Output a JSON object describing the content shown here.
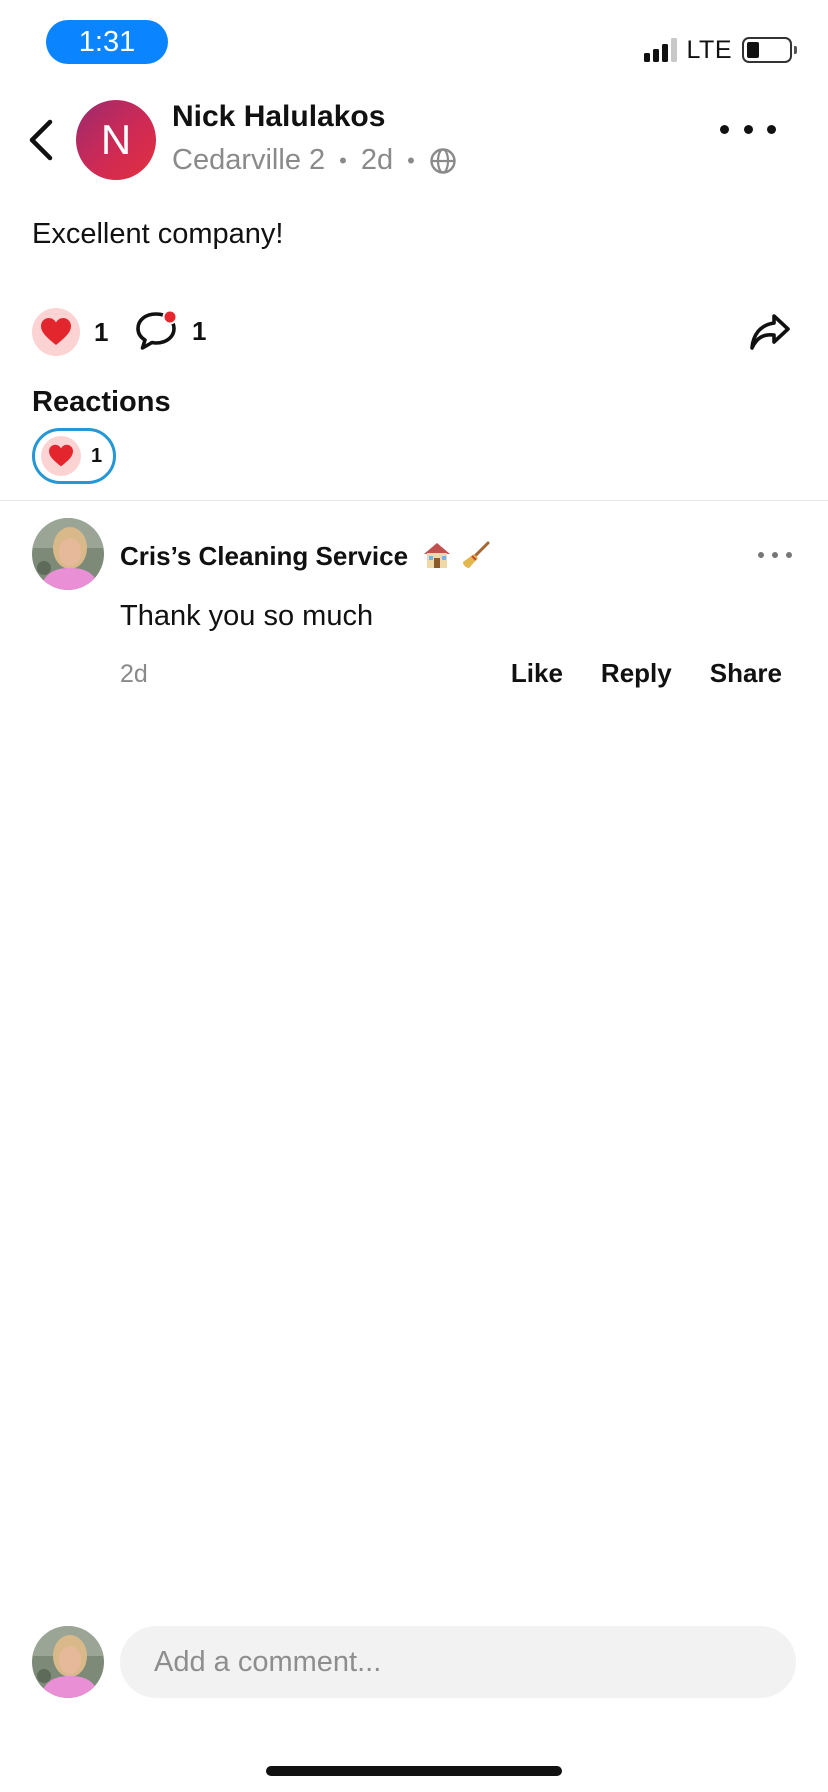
{
  "status_bar": {
    "time": "1:31",
    "network": "LTE",
    "accent_color": "#0a84ff"
  },
  "post": {
    "author_initial": "N",
    "author_name": "Nick Halulakos",
    "location": "Cedarville 2",
    "age": "2d",
    "visibility_icon": "globe-icon",
    "text": "Excellent company!",
    "reaction_count": "1",
    "comment_count": "1"
  },
  "reactions": {
    "title": "Reactions",
    "items": [
      {
        "icon": "heart-icon",
        "count": "1"
      }
    ],
    "chip_border_color": "#2596d6"
  },
  "comment": {
    "author": "Cris’s Cleaning Service",
    "author_emojis": [
      "house-icon",
      "broom-icon"
    ],
    "text": "Thank you so much",
    "age": "2d",
    "actions": {
      "like": "Like",
      "reply": "Reply",
      "share": "Share"
    }
  },
  "composer": {
    "placeholder": "Add a comment..."
  }
}
